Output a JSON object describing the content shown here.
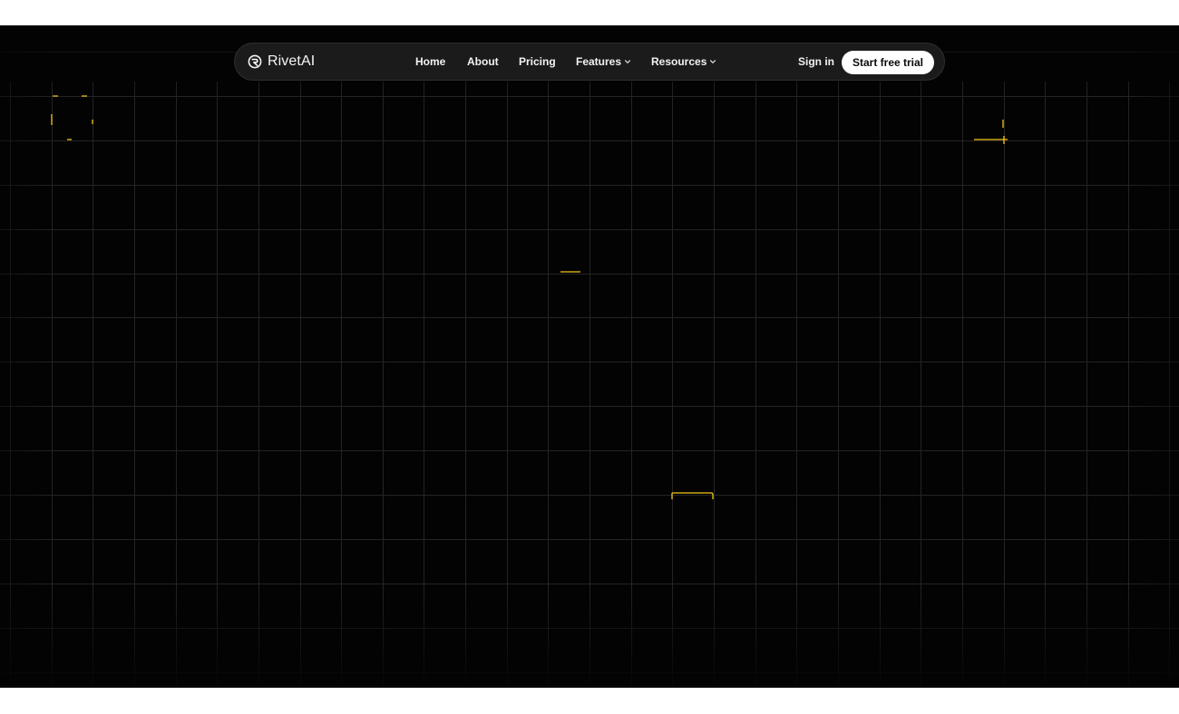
{
  "brand": {
    "name": "RivetAI",
    "logo_icon": "rivet-r-icon"
  },
  "nav": {
    "home": "Home",
    "about": "About",
    "pricing": "Pricing",
    "features": "Features",
    "resources": "Resources"
  },
  "auth": {
    "sign_in": "Sign in",
    "cta": "Start free trial"
  },
  "colors": {
    "background": "#030303",
    "navbar": "#1b1b1b",
    "grid_line": "#262626",
    "accent": "#f5c518",
    "cta_bg": "#ffffff",
    "cta_text": "#0a0a0a"
  }
}
